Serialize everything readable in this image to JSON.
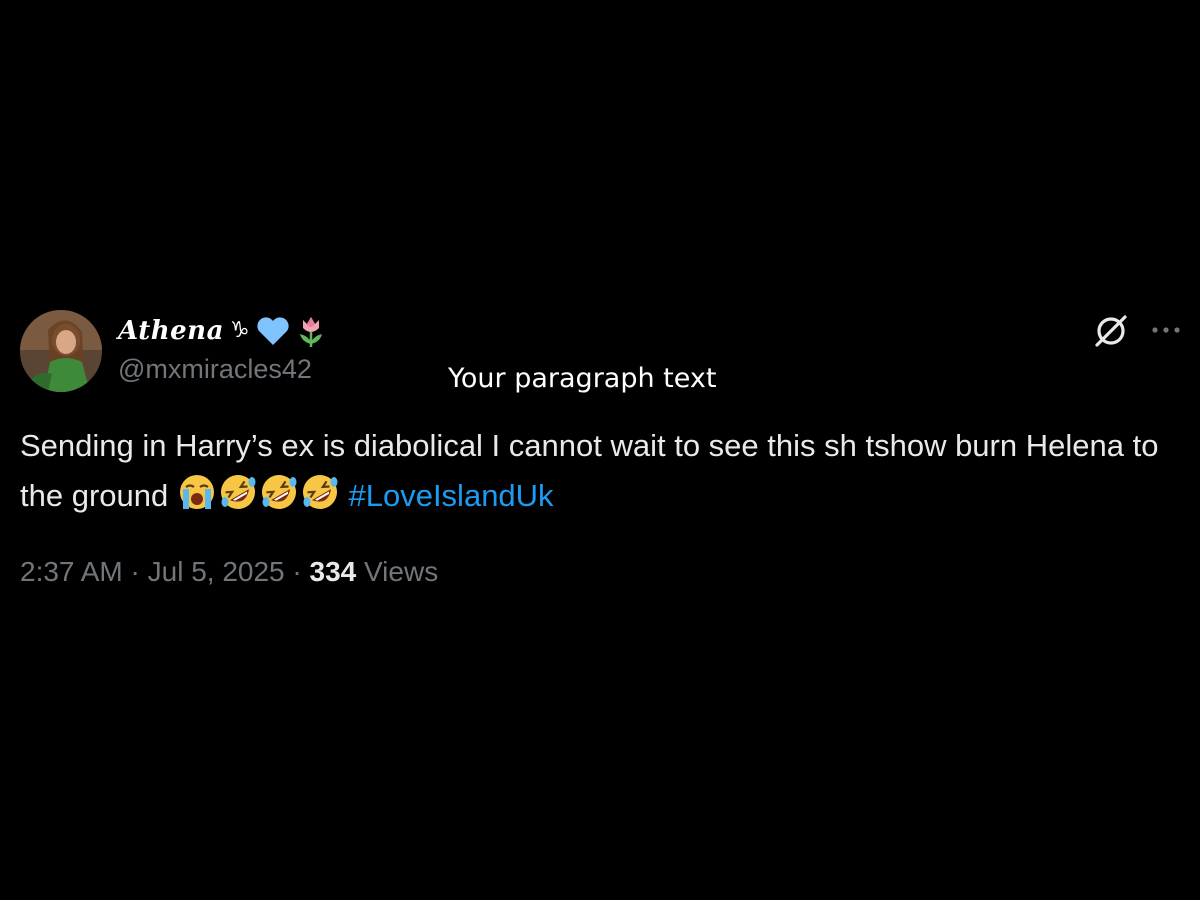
{
  "author": {
    "display_name": "Athena",
    "name_emojis": [
      "capricorn-glyph",
      "light-blue-heart",
      "tulip"
    ],
    "capricorn_symbol": "♑",
    "handle": "@mxmiracles42"
  },
  "overlay": {
    "paragraph_text": "Your paragraph text"
  },
  "tweet": {
    "text_part1": "Sending in Harry’s ex is diabolical I cannot wait to see this sh tshow burn Helena to the ground",
    "emojis": [
      "loudly-crying-face",
      "rolling-on-floor-laughing",
      "rolling-on-floor-laughing",
      "rolling-on-floor-laughing"
    ],
    "hashtag": "#LoveIslandUk"
  },
  "meta": {
    "time": "2:37 AM",
    "separator": "·",
    "date": "Jul 5, 2025",
    "views_count": "334",
    "views_label": "Views"
  },
  "colors": {
    "background": "#000000",
    "text": "#e7e9ea",
    "muted": "#71767b",
    "link": "#1d9bf0",
    "heart": "#7fc4ff"
  }
}
